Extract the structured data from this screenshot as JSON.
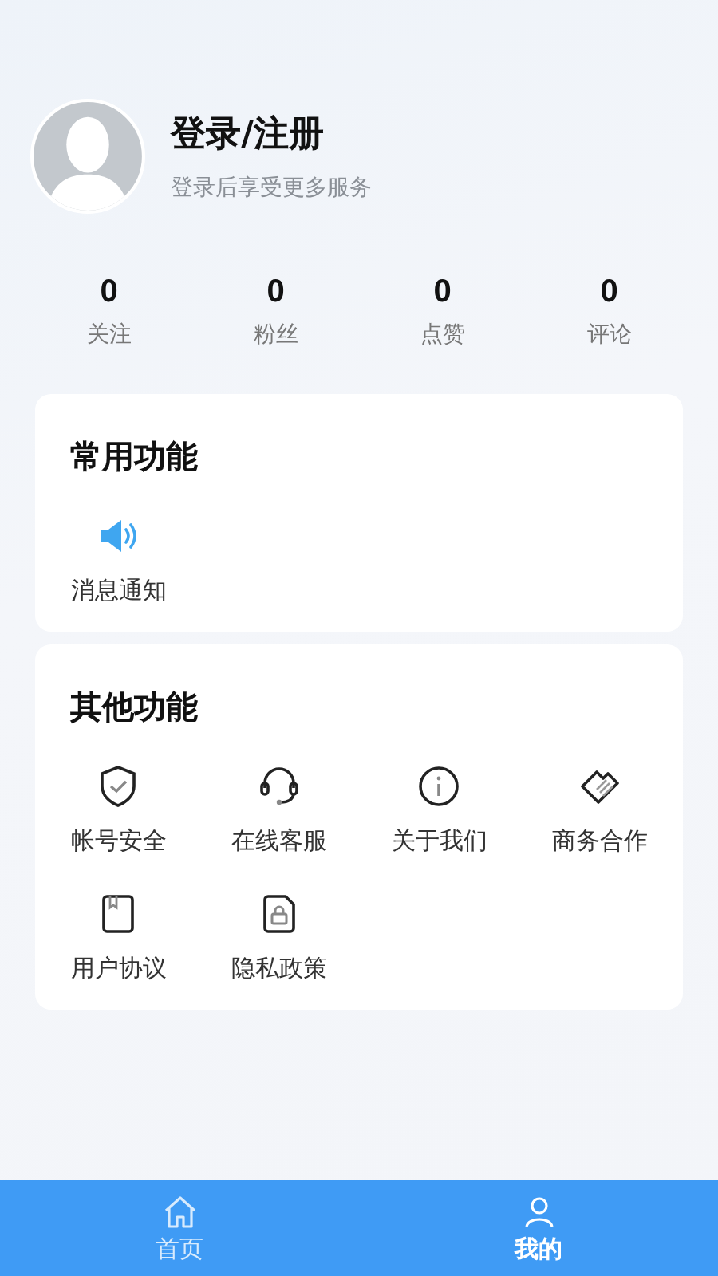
{
  "profile": {
    "title": "登录/注册",
    "subtitle": "登录后享受更多服务"
  },
  "stats": [
    {
      "value": "0",
      "label": "关注"
    },
    {
      "value": "0",
      "label": "粉丝"
    },
    {
      "value": "0",
      "label": "点赞"
    },
    {
      "value": "0",
      "label": "评论"
    }
  ],
  "sections": [
    {
      "title": "常用功能",
      "items": [
        {
          "kind": "speaker",
          "label": "消息通知"
        }
      ]
    },
    {
      "title": "其他功能",
      "items": [
        {
          "kind": "shield",
          "label": "帐号安全"
        },
        {
          "kind": "headset",
          "label": "在线客服"
        },
        {
          "kind": "info",
          "label": "关于我们"
        },
        {
          "kind": "handshake",
          "label": "商务合作"
        },
        {
          "kind": "book",
          "label": "用户协议"
        },
        {
          "kind": "lockdoc",
          "label": "隐私政策"
        }
      ]
    }
  ],
  "tabs": [
    {
      "kind": "home",
      "label": "首页",
      "selected": false
    },
    {
      "kind": "person",
      "label": "我的",
      "selected": true
    }
  ]
}
